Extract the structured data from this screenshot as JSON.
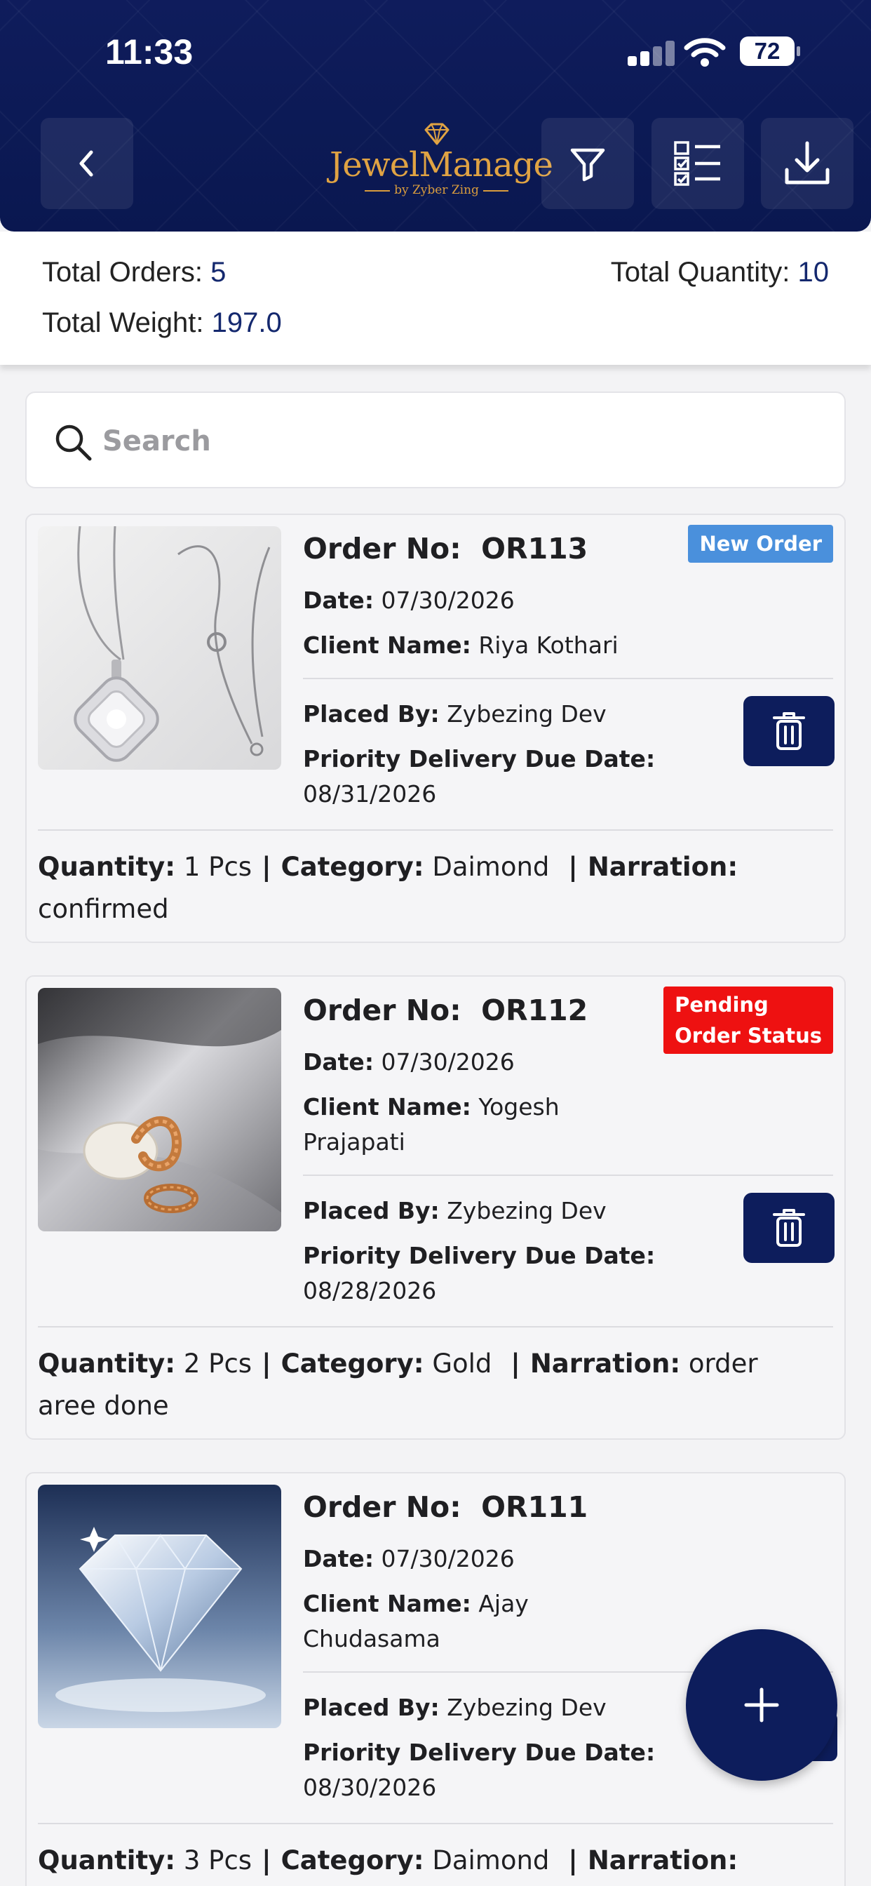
{
  "status_bar": {
    "time": "11:33",
    "battery": "72"
  },
  "header": {
    "app_name": "JewelManage",
    "app_sub": "by Zyber Zing"
  },
  "summary": {
    "total_orders_label": "Total Orders:",
    "total_orders_value": "5",
    "total_quantity_label": "Total Quantity:",
    "total_quantity_value": "10",
    "total_weight_label": "Total Weight:",
    "total_weight_value": "197.0"
  },
  "search": {
    "placeholder": "Search"
  },
  "labels": {
    "order_no": "Order No:",
    "date": "Date:",
    "client_name": "Client Name:",
    "placed_by": "Placed By:",
    "priority": "Priority Delivery Due Date:",
    "quantity": "Quantity:",
    "category": "Category:",
    "narration": "Narration:"
  },
  "orders": [
    {
      "order_no": "OR113",
      "status": "New Order",
      "date": "07/30/2026",
      "client_line1": "Riya Kothari",
      "client_line2": "",
      "placed_by": "Zybezing Dev",
      "due_date": "08/31/2026",
      "quantity": "1 Pcs",
      "category": "Daimond",
      "narration": "",
      "narration_line2": "confirmed"
    },
    {
      "order_no": "OR112",
      "status_line1": "Pending",
      "status_line2": "Order Status",
      "date": "07/30/2026",
      "client_line1": "Yogesh",
      "client_line2": "Prajapati",
      "placed_by": "Zybezing Dev",
      "due_date": "08/28/2026",
      "quantity": "2 Pcs",
      "category": "Gold",
      "narration": "order",
      "narration_line2": "aree done"
    },
    {
      "order_no": "OR111",
      "date": "07/30/2026",
      "client_line1": "Ajay",
      "client_line2": "Chudasama",
      "placed_by": "Zybezing Dev",
      "due_date": "08/30/2026",
      "quantity": "3 Pcs",
      "category": "Daimond",
      "narration": ""
    }
  ],
  "icons": {
    "back": "chevron-left-icon",
    "filter": "filter-icon",
    "checklist": "checklist-icon",
    "download": "download-icon",
    "search": "search-icon",
    "delete": "trash-icon",
    "add": "plus-icon"
  },
  "colors": {
    "header": "#0c1a55",
    "accent_gold": "#e0a343",
    "button_navy": "#0d1d5c",
    "badge_new": "#4a90dc",
    "badge_pending": "#ee1111",
    "summary_value": "#14286e"
  }
}
